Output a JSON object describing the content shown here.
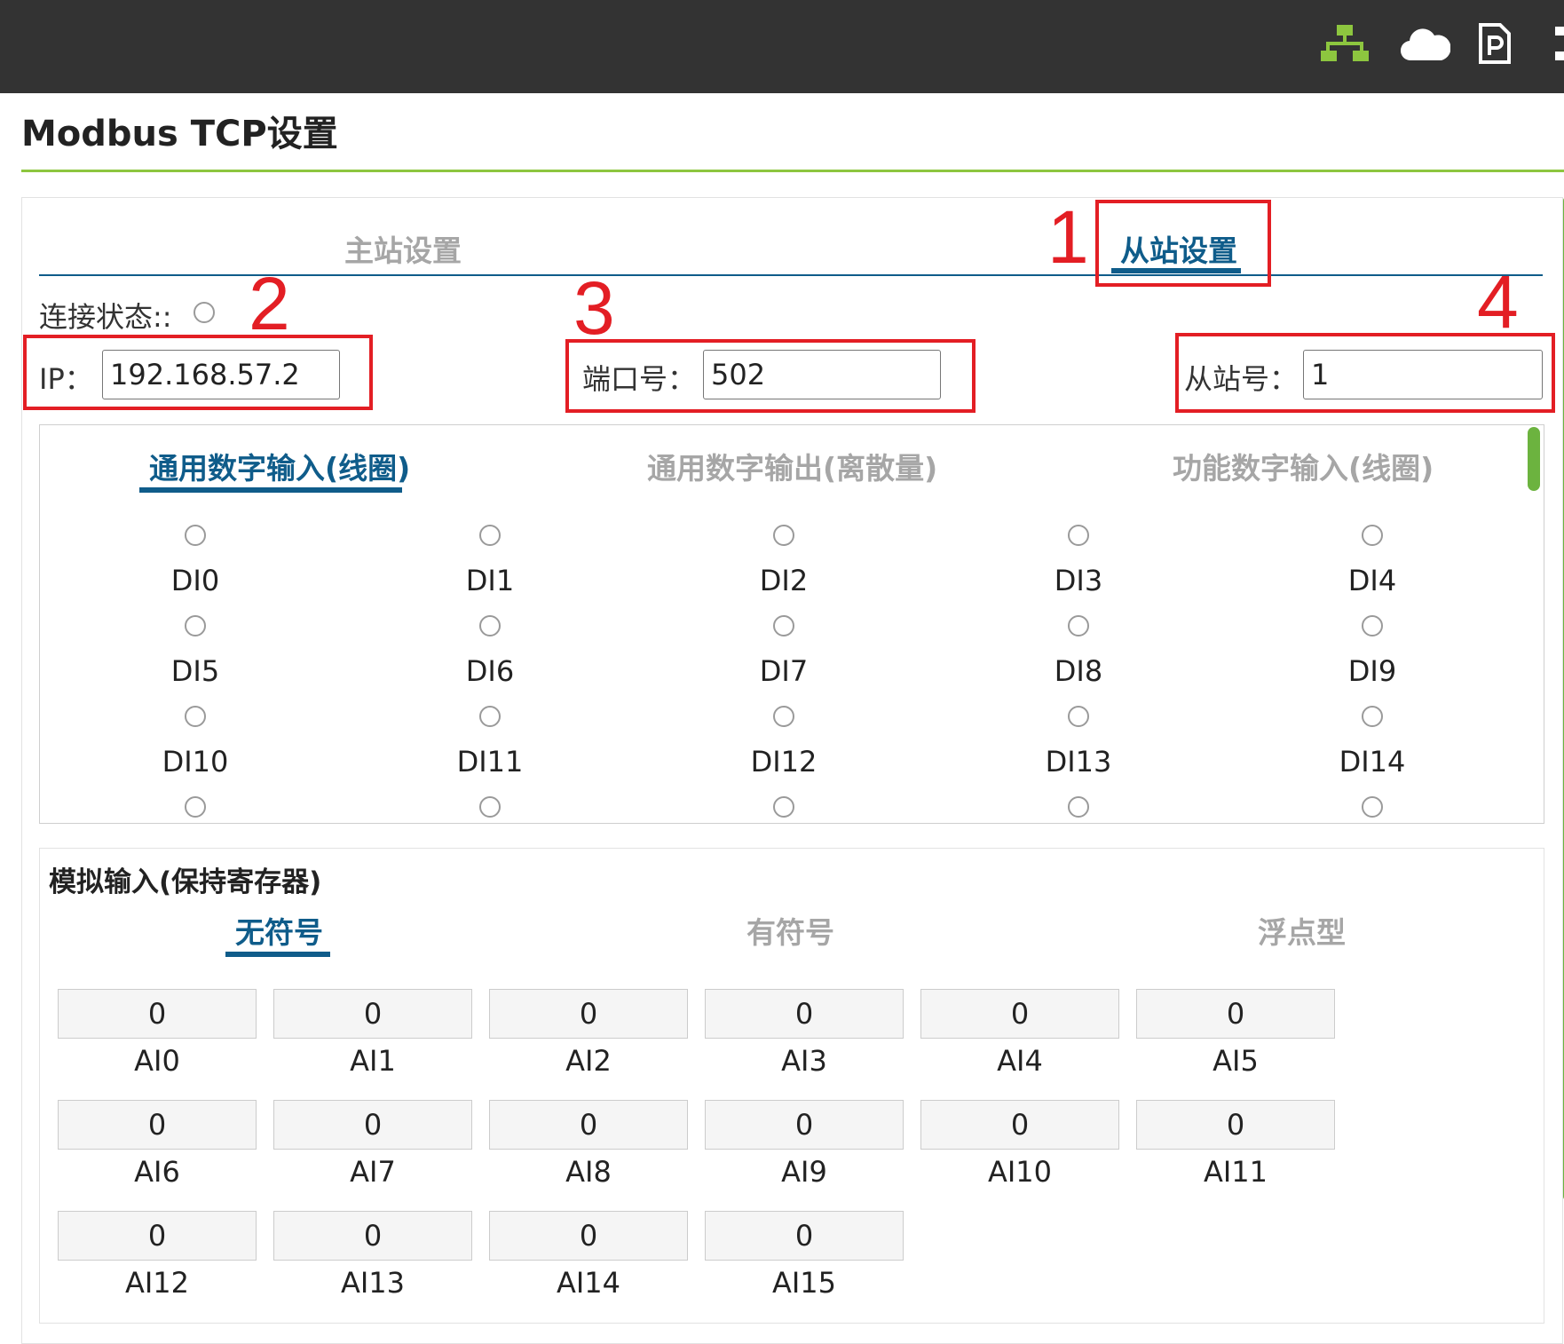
{
  "header": {
    "icons": [
      "network-icon",
      "cloud-icon",
      "document-p-icon",
      "menu-icon"
    ]
  },
  "page": {
    "title": "Modbus TCP设置"
  },
  "tabs": {
    "master": "主站设置",
    "slave": "从站设置"
  },
  "connection": {
    "label": "连接状态::"
  },
  "ip": {
    "label": "IP：",
    "value": "192.168.57.2"
  },
  "port": {
    "label": "端口号：",
    "value": "502"
  },
  "slave_id": {
    "label": "从站号：",
    "value": "1"
  },
  "annotations": {
    "n1": "1",
    "n2": "2",
    "n3": "3",
    "n4": "4"
  },
  "digital_tabs": {
    "di": "通用数字输入(线圈)",
    "do": "通用数字输出(离散量)",
    "fdi": "功能数字输入(线圈)"
  },
  "digital_inputs": [
    "DI0",
    "DI1",
    "DI2",
    "DI3",
    "DI4",
    "DI5",
    "DI6",
    "DI7",
    "DI8",
    "DI9",
    "DI10",
    "DI11",
    "DI12",
    "DI13",
    "DI14"
  ],
  "analog": {
    "title": "模拟输入(保持寄存器)",
    "tabs": {
      "unsigned": "无符号",
      "signed": "有符号",
      "float": "浮点型"
    },
    "items": [
      {
        "label": "AI0",
        "value": "0"
      },
      {
        "label": "AI1",
        "value": "0"
      },
      {
        "label": "AI2",
        "value": "0"
      },
      {
        "label": "AI3",
        "value": "0"
      },
      {
        "label": "AI4",
        "value": "0"
      },
      {
        "label": "AI5",
        "value": "0"
      },
      {
        "label": "AI6",
        "value": "0"
      },
      {
        "label": "AI7",
        "value": "0"
      },
      {
        "label": "AI8",
        "value": "0"
      },
      {
        "label": "AI9",
        "value": "0"
      },
      {
        "label": "AI10",
        "value": "0"
      },
      {
        "label": "AI11",
        "value": "0"
      },
      {
        "label": "AI12",
        "value": "0"
      },
      {
        "label": "AI13",
        "value": "0"
      },
      {
        "label": "AI14",
        "value": "0"
      },
      {
        "label": "AI15",
        "value": "0"
      }
    ]
  },
  "colors": {
    "accent_green": "#8dc63f",
    "tab_blue": "#0f5c8a",
    "annotation_red": "#e31e24",
    "topbar": "#333333"
  }
}
